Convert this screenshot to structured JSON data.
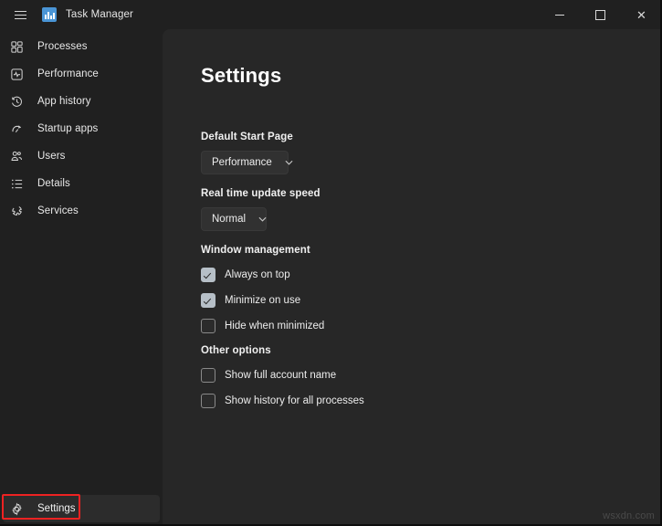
{
  "window": {
    "title": "Task Manager",
    "app_icon": "task-manager-chart-icon",
    "menu_icon": "hamburger-menu-icon",
    "controls": {
      "minimize": "–",
      "maximize": "□",
      "close": "✕"
    },
    "accent_color": "#4a95d6",
    "background_color": "#202020",
    "content_background_color": "#272727"
  },
  "sidebar": {
    "items": [
      {
        "label": "Processes",
        "icon": "processes-grid-icon",
        "selected": false
      },
      {
        "label": "Performance",
        "icon": "performance-pulse-icon",
        "selected": false
      },
      {
        "label": "App history",
        "icon": "history-clock-icon",
        "selected": false
      },
      {
        "label": "Startup apps",
        "icon": "startup-rocket-icon",
        "selected": false
      },
      {
        "label": "Users",
        "icon": "users-people-icon",
        "selected": false
      },
      {
        "label": "Details",
        "icon": "details-list-icon",
        "selected": false
      },
      {
        "label": "Services",
        "icon": "services-gear-icon",
        "selected": false
      }
    ],
    "settings": {
      "label": "Settings",
      "icon": "settings-gear-icon",
      "selected": true,
      "highlight_color": "#ee2222"
    }
  },
  "main": {
    "title": "Settings",
    "groups": [
      {
        "label": "Default Start Page",
        "control": "dropdown",
        "value": "Performance",
        "chevron": "⌄"
      },
      {
        "label": "Real time update speed",
        "control": "dropdown",
        "value": "Normal",
        "chevron": "⌄"
      },
      {
        "label": "Window management",
        "control": "checkboxes",
        "options": [
          {
            "label": "Always on top",
            "checked": true
          },
          {
            "label": "Minimize on use",
            "checked": true
          },
          {
            "label": "Hide when minimized",
            "checked": false
          }
        ]
      },
      {
        "label": "Other options",
        "control": "checkboxes",
        "options": [
          {
            "label": "Show full account name",
            "checked": false
          },
          {
            "label": "Show history for all processes",
            "checked": false
          }
        ]
      }
    ]
  },
  "watermark": "wsxdn.com"
}
